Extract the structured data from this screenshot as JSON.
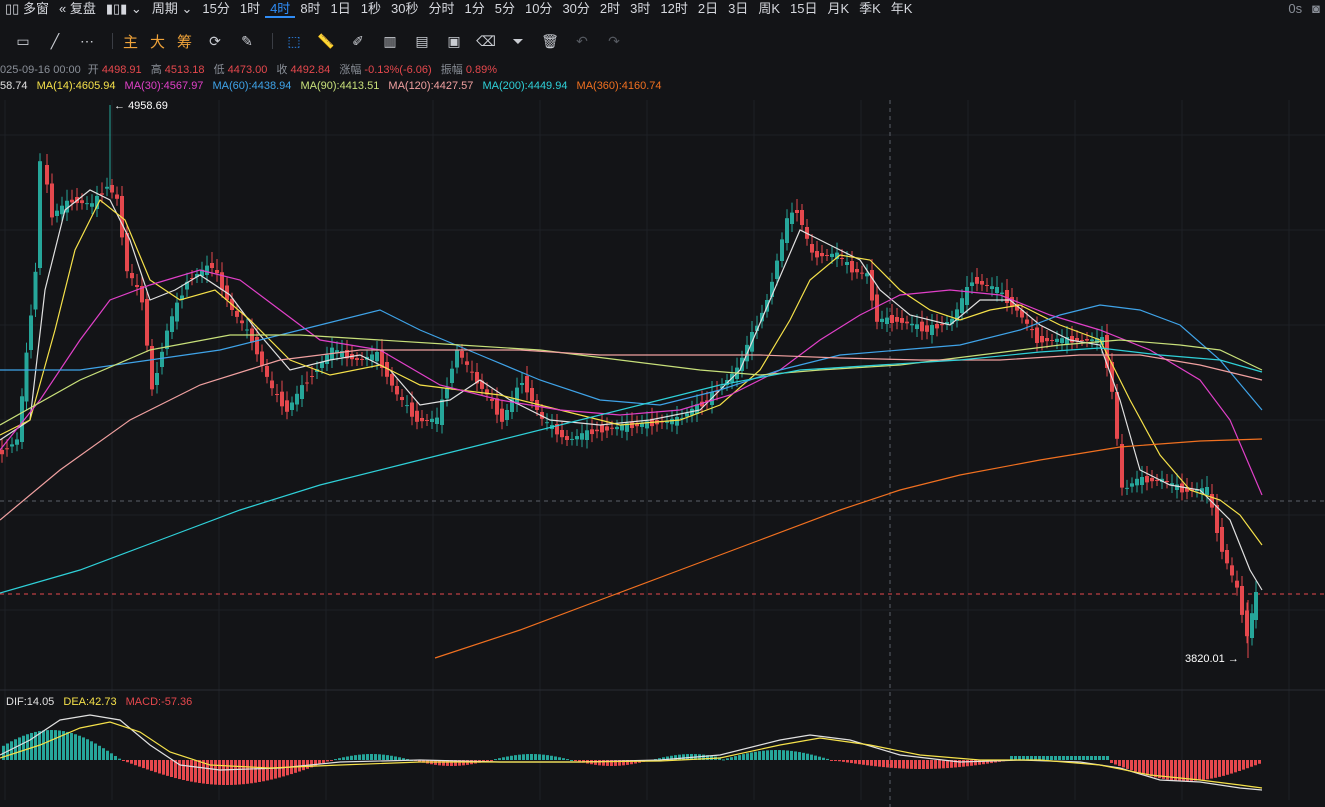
{
  "toolbar": {
    "multi_window": "多窗",
    "replay": "复盘",
    "period": "周期",
    "intervals": [
      "15分",
      "1时",
      "4时",
      "8时",
      "1日",
      "1秒",
      "30秒",
      "分时",
      "1分",
      "5分",
      "10分",
      "30分",
      "2时",
      "3时",
      "12时",
      "2日",
      "3日",
      "周K",
      "15日",
      "月K",
      "季K",
      "年K"
    ],
    "active_interval": "4时",
    "countdown": "0s"
  },
  "drawing_tools": {
    "main": "主",
    "big": "大",
    "chips": "筹"
  },
  "ohlc": {
    "date": "025-09-16 00:00",
    "open_label": "开",
    "open": "4498.91",
    "high_label": "高",
    "high": "4513.18",
    "low_label": "低",
    "low": "4473.00",
    "close_label": "收",
    "close": "4492.84",
    "change_label": "涨幅",
    "change": "-0.13%(-6.06)",
    "amplitude_label": "振幅",
    "amplitude": "0.89%"
  },
  "ma": {
    "ma7": "58.74",
    "ma14": "MA(14):4605.94",
    "ma30": "MA(30):4567.97",
    "ma60": "MA(60):4438.94",
    "ma90": "MA(90):4413.51",
    "ma120": "MA(120):4427.57",
    "ma200": "MA(200):4449.94",
    "ma360": "MA(360):4160.74"
  },
  "colors": {
    "up": "#26a69a",
    "down": "#e5484d",
    "ma7": "#e0e0e0",
    "ma14": "#f5e14a",
    "ma30": "#e040c8",
    "ma60": "#3fa3e8",
    "ma90": "#c8e07a",
    "ma120": "#f0a0a0",
    "ma200": "#2fd0d8",
    "ma360": "#f07020"
  },
  "high_marker": "4958.69",
  "low_marker": "3820.01",
  "macd": {
    "dif": "DIF:14.05",
    "dea": "DEA:42.73",
    "macd": "MACD:-57.36"
  }
}
